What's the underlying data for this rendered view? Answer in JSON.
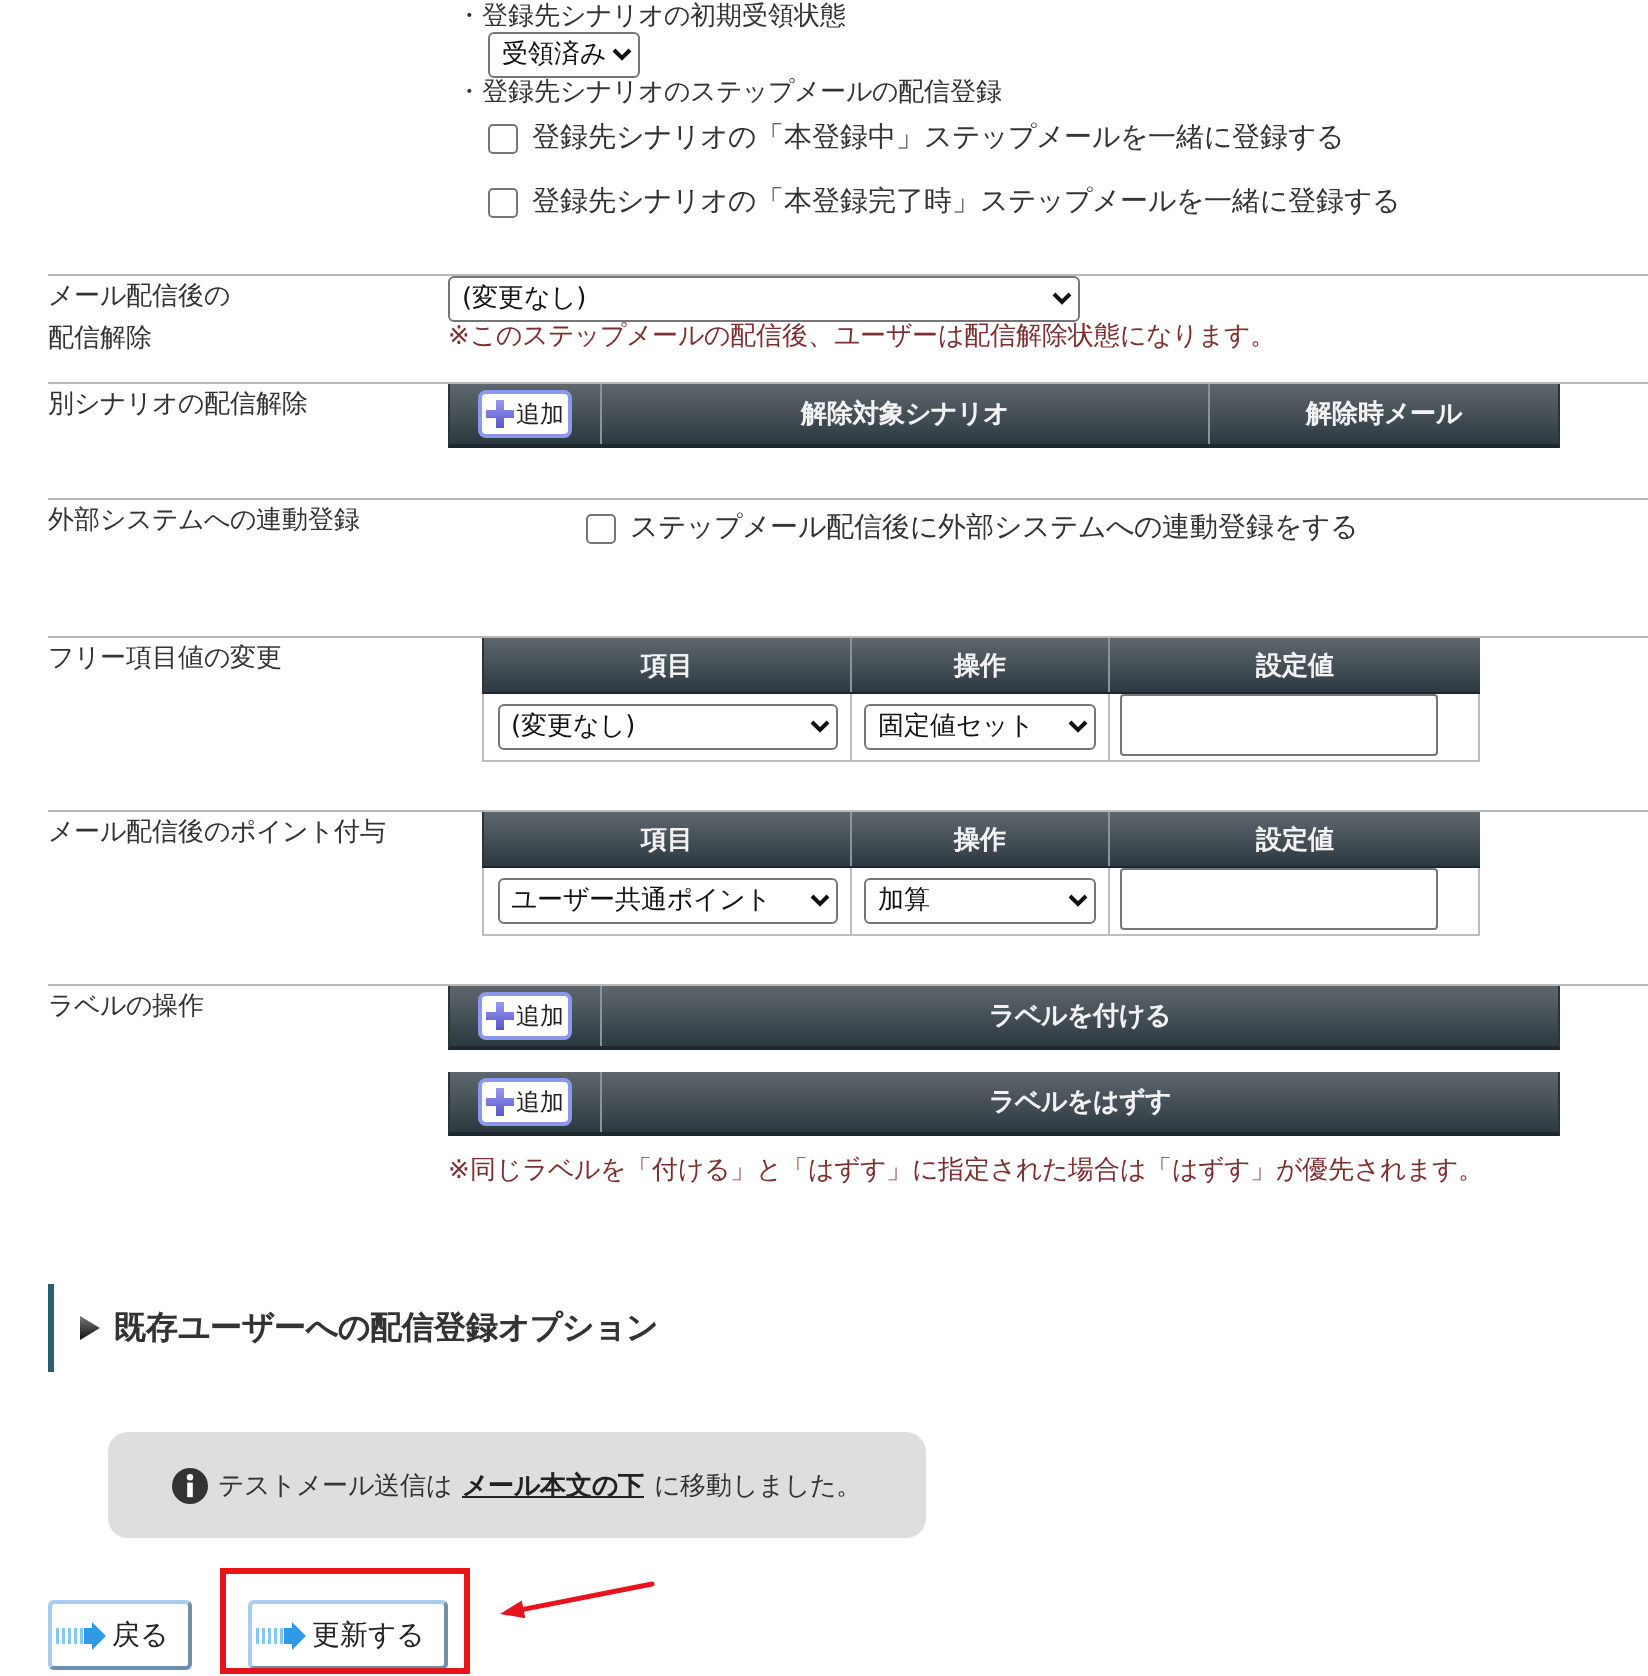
{
  "initial_state": {
    "label": "・登録先シナリオの初期受領状態",
    "select": "受領済み"
  },
  "step_mail": {
    "label": "・登録先シナリオのステップメールの配信登録",
    "options": [
      {
        "label": "登録先シナリオの「本登録中」ステップメールを一緒に登録する",
        "checked": false
      },
      {
        "label": "登録先シナリオの「本登録完了時」ステップメールを一緒に登録する",
        "checked": false
      }
    ]
  },
  "sections": [
    {
      "kind": "select",
      "label": "メール配信後の配信解除",
      "select": "(変更なし)",
      "note": "※このステップメールの配信後、ユーザーは配信解除状態になります。"
    },
    {
      "kind": "bars",
      "label": "別シナリオの配信解除",
      "bars": [
        {
          "add_button": "追加",
          "columns": [
            "解除対象シナリオ",
            "解除時メール"
          ]
        }
      ]
    },
    {
      "kind": "checkbox",
      "label": "外部システムへの連動登録",
      "checkbox": {
        "label": "ステップメール配信後に外部システムへの連動登録をする",
        "checked": false
      }
    },
    {
      "kind": "grid",
      "label": "フリー項目値の変更",
      "columns": [
        "項目",
        "操作",
        "設定値"
      ],
      "row": {
        "item": "(変更なし)",
        "operation": "固定値セット"
      }
    },
    {
      "kind": "grid",
      "label": "メール配信後のポイント付与",
      "columns": [
        "項目",
        "操作",
        "設定値"
      ],
      "row": {
        "item": "ユーザー共通ポイント",
        "operation": "加算"
      }
    },
    {
      "kind": "bars",
      "label": "ラベルの操作",
      "bars": [
        {
          "add_button": "追加",
          "columns": [
            "ラベルを付ける"
          ]
        },
        {
          "add_button": "追加",
          "columns": [
            "ラベルをはずす"
          ]
        }
      ],
      "note": "※同じラベルを「付ける」と「はずす」に指定された場合は「はずす」が優先されます。"
    }
  ],
  "collapsible_section": {
    "title": "既存ユーザーへの配信登録オプション",
    "expanded": false
  },
  "info_message": {
    "text_before": "テストメール送信は",
    "link": "メール本文の下",
    "text_after": "に移動しました。"
  },
  "buttons": [
    {
      "label": "戻る",
      "highlighted": false
    },
    {
      "label": "更新する",
      "highlighted": true
    }
  ]
}
